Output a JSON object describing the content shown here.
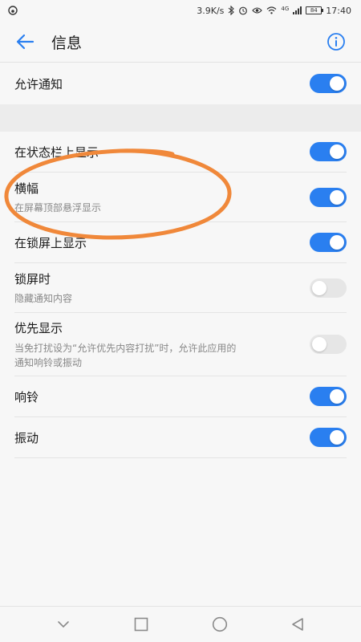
{
  "status_bar": {
    "speed": "3.9K/s",
    "network": "4G",
    "battery": "84",
    "time": "17:40"
  },
  "header": {
    "title": "信息"
  },
  "settings": {
    "allow_notifications": {
      "title": "允许通知",
      "on": true
    },
    "status_bar_display": {
      "title": "在状态栏上显示",
      "on": true
    },
    "banner": {
      "title": "横幅",
      "subtitle": "在屏幕顶部悬浮显示",
      "on": true
    },
    "lock_screen_display": {
      "title": "在锁屏上显示",
      "on": true
    },
    "lock_screen_time": {
      "title": "锁屏时",
      "subtitle": "隐藏通知内容",
      "on": false
    },
    "priority_display": {
      "title": "优先显示",
      "subtitle_line1": "当免打扰设为“允许优先内容打扰”时，允许此应用的",
      "subtitle_line2": "通知响铃或振动",
      "on": false
    },
    "ringtone": {
      "title": "响铃",
      "on": true
    },
    "vibration": {
      "title": "振动",
      "on": true
    }
  },
  "colors": {
    "accent": "#2a7ff0",
    "annotation": "#f0883a"
  },
  "icons": {
    "back": "arrow-left",
    "info": "info-circle",
    "nav": [
      "chevron-down",
      "square",
      "circle",
      "triangle-left"
    ]
  }
}
